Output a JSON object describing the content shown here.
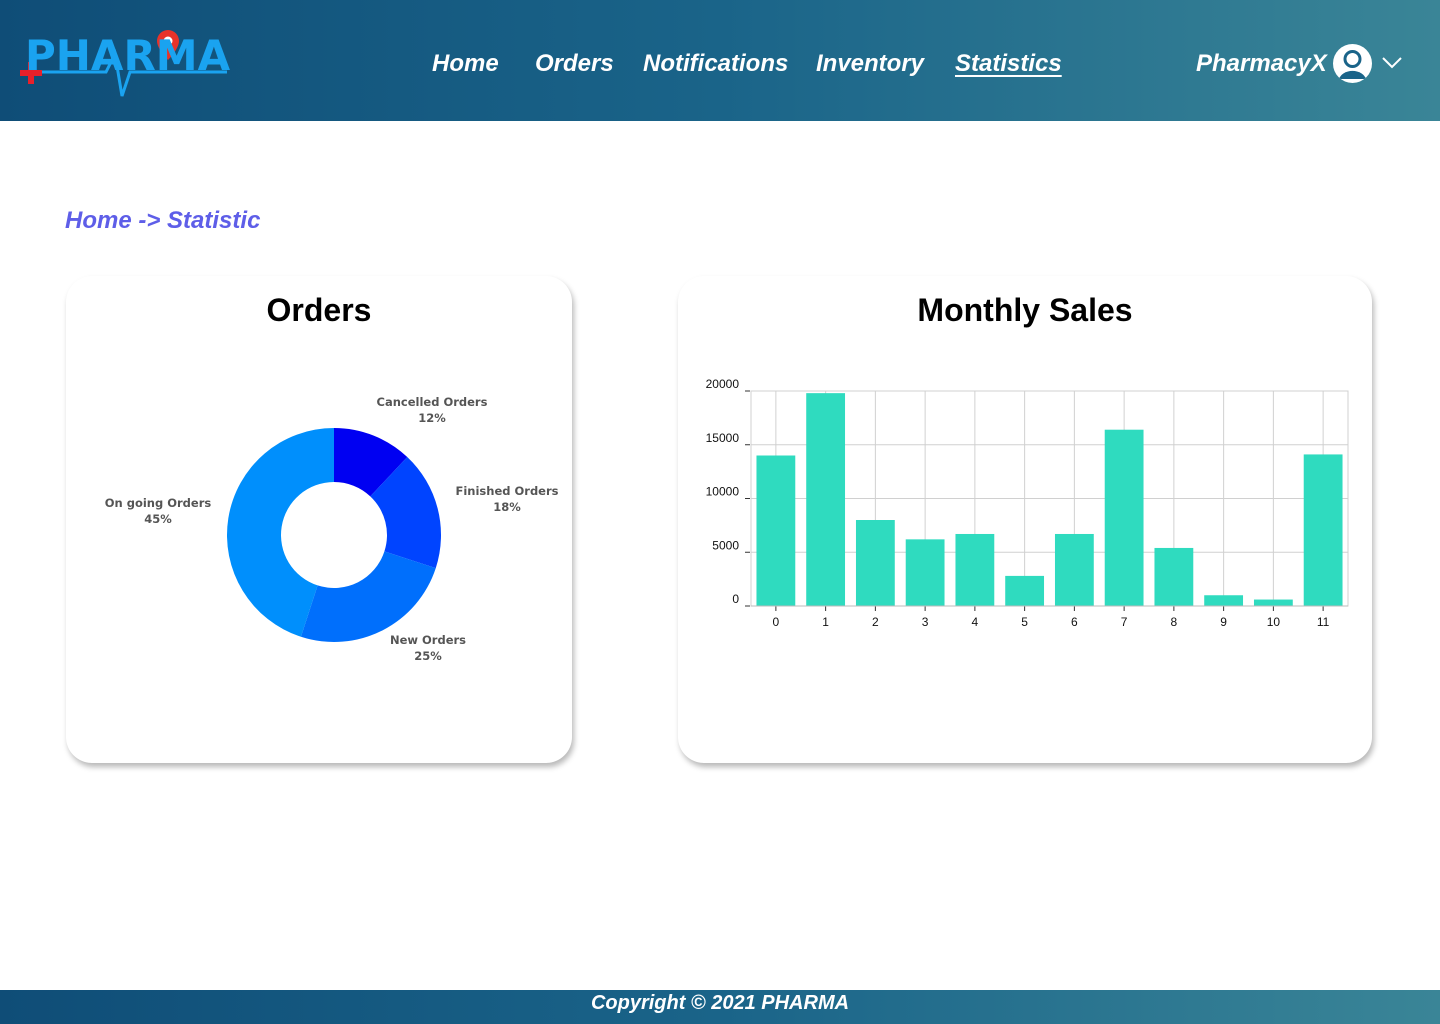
{
  "header": {
    "logo_text": "PHARMA",
    "nav": [
      {
        "label": "Home",
        "active": false
      },
      {
        "label": "Orders",
        "active": false
      },
      {
        "label": "Notifications",
        "active": false
      },
      {
        "label": "Inventory",
        "active": false
      },
      {
        "label": "Statistics",
        "active": true
      }
    ],
    "user": {
      "name": "PharmacyX",
      "avatar_icon": "user-icon",
      "menu_icon": "chevron-down-icon"
    }
  },
  "breadcrumb": {
    "home": "Home",
    "separator": "->",
    "current": "Statistic"
  },
  "cards": {
    "orders_title": "Orders",
    "sales_title": "Monthly Sales"
  },
  "colors": {
    "header_start": "#0f4d77",
    "header_end": "#3a8597",
    "breadcrumb": "#5e5ee8",
    "bar": "#2fdbbf",
    "donut": [
      "#0000f2",
      "#0044ff",
      "#006ffc",
      "#008ffc"
    ]
  },
  "chart_data": [
    {
      "type": "pie",
      "title": "Orders",
      "donut": true,
      "slices": [
        {
          "label": "Cancelled Orders",
          "value": 12,
          "display": "12%"
        },
        {
          "label": "Finished Orders",
          "value": 18,
          "display": "18%"
        },
        {
          "label": "New Orders",
          "value": 25,
          "display": "25%"
        },
        {
          "label": "On going Orders",
          "value": 45,
          "display": "45%"
        }
      ]
    },
    {
      "type": "bar",
      "title": "Monthly Sales",
      "categories": [
        "0",
        "1",
        "2",
        "3",
        "4",
        "5",
        "6",
        "7",
        "8",
        "9",
        "10",
        "11"
      ],
      "values": [
        14000,
        19800,
        8000,
        6200,
        6700,
        2800,
        6700,
        16400,
        5400,
        1000,
        600,
        14100
      ],
      "ylim": [
        0,
        20000
      ],
      "yticks": [
        0,
        5000,
        10000,
        15000,
        20000
      ],
      "grid": true,
      "xlabel": "",
      "ylabel": ""
    }
  ],
  "footer": {
    "text": "Copyright © 2021 PHARMA"
  }
}
